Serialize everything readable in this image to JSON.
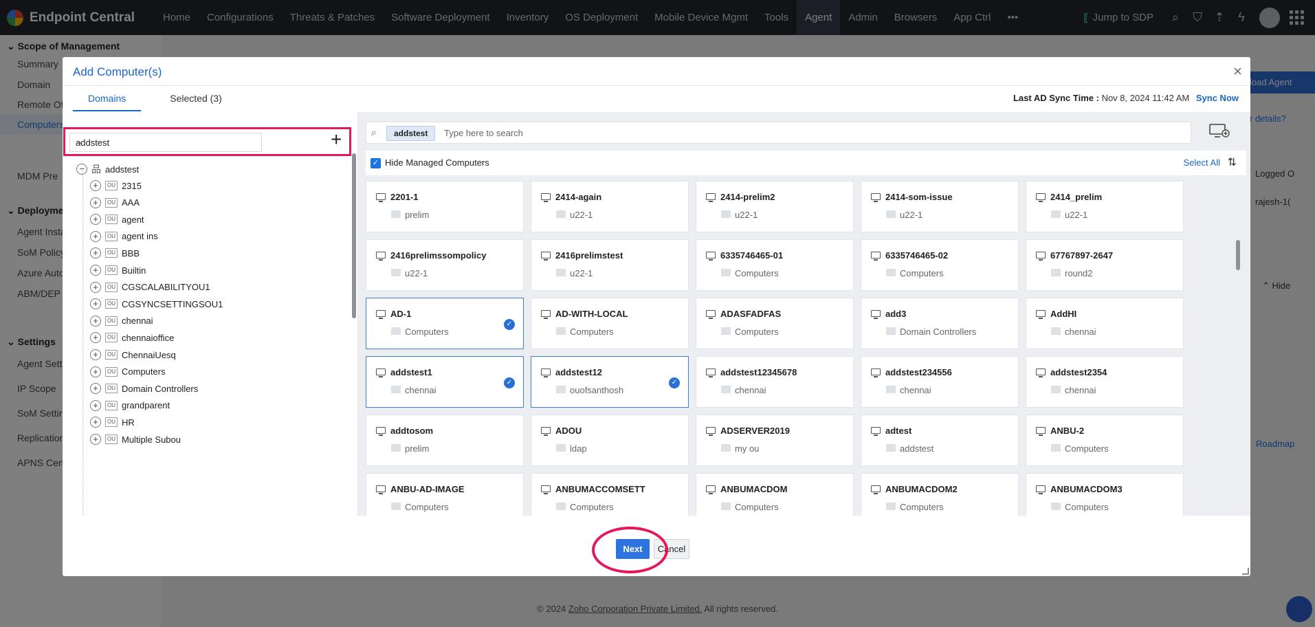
{
  "app": {
    "title": "Endpoint Central"
  },
  "nav": {
    "items": [
      "Home",
      "Configurations",
      "Threats & Patches",
      "Software Deployment",
      "Inventory",
      "OS Deployment",
      "Mobile Device Mgmt",
      "Tools",
      "Agent",
      "Admin",
      "Browsers",
      "App Ctrl"
    ],
    "active": "Agent",
    "more_icon": "more-horizontal-icon",
    "jump_label": "Jump to SDP"
  },
  "sidebar": {
    "scope_title": "Scope of Management",
    "scope_items": [
      "Summary",
      "Domain",
      "Remote Of",
      "Computers",
      "MDM Pre"
    ],
    "deploy_title": "Deployment",
    "deploy_items": [
      "Agent Insta",
      "SoM Policy",
      "Azure Auto",
      "ABM/DEP"
    ],
    "settings_title": "Settings",
    "settings_items": [
      "Agent Setti",
      "IP Scope",
      "SoM Settin",
      "Replication",
      "APNS Cert"
    ]
  },
  "background": {
    "download_btn": "load Agent",
    "details_link": "r details?",
    "logged_col": "Logged O",
    "rajesh": "rajesh-1(",
    "hide": "Hide",
    "roadmap": "Roadmap",
    "footer_copyright": "© 2024",
    "footer_company": "Zoho Corporation Private Limited.",
    "footer_rights": "All rights reserved."
  },
  "modal": {
    "title": "Add Computer(s)",
    "close": "×",
    "tabs": [
      "Domains",
      "Selected (3)"
    ],
    "sync_label": "Last AD Sync Time :",
    "sync_time": "Nov 8, 2024 11:42 AM",
    "sync_now": "Sync Now",
    "domain_value": "addstest",
    "tree_root": "addstest",
    "ou_label": "OU",
    "tree_nodes": [
      "2315",
      "AAA",
      "agent",
      "agent ins",
      "BBB",
      "Builtin",
      "CGSCALABILITYOU1",
      "CGSYNCSETTINGSOU1",
      "chennai",
      "chennaioffice",
      "ChennaiUesq",
      "Computers",
      "Domain Controllers",
      "grandparent",
      "HR",
      "Multiple Subou"
    ],
    "search_chip": "addstest",
    "search_placeholder": "Type here to search",
    "hide_managed": "Hide Managed Computers",
    "select_all": "Select All",
    "cards": [
      {
        "name": "2201-1",
        "ou": "prelim",
        "selected": false
      },
      {
        "name": "2414-again",
        "ou": "u22-1",
        "selected": false
      },
      {
        "name": "2414-prelim2",
        "ou": "u22-1",
        "selected": false
      },
      {
        "name": "2414-som-issue",
        "ou": "u22-1",
        "selected": false
      },
      {
        "name": "2414_prelim",
        "ou": "u22-1",
        "selected": false
      },
      {
        "name": "2416prelimssompolicy",
        "ou": "u22-1",
        "selected": false
      },
      {
        "name": "2416prelimstest",
        "ou": "u22-1",
        "selected": false
      },
      {
        "name": "6335746465-01",
        "ou": "Computers",
        "selected": false
      },
      {
        "name": "6335746465-02",
        "ou": "Computers",
        "selected": false
      },
      {
        "name": "67767897-2647",
        "ou": "round2",
        "selected": false
      },
      {
        "name": "AD-1",
        "ou": "Computers",
        "selected": true
      },
      {
        "name": "AD-WITH-LOCAL",
        "ou": "Computers",
        "selected": false
      },
      {
        "name": "ADASFADFAS",
        "ou": "Computers",
        "selected": false
      },
      {
        "name": "add3",
        "ou": "Domain Controllers",
        "selected": false
      },
      {
        "name": "AddHI",
        "ou": "chennai",
        "selected": false
      },
      {
        "name": "addstest1",
        "ou": "chennai",
        "selected": true
      },
      {
        "name": "addstest12",
        "ou": "ouofsanthosh",
        "selected": true
      },
      {
        "name": "addstest12345678",
        "ou": "chennai",
        "selected": false
      },
      {
        "name": "addstest234556",
        "ou": "chennai",
        "selected": false
      },
      {
        "name": "addstest2354",
        "ou": "chennai",
        "selected": false
      },
      {
        "name": "addtosom",
        "ou": "prelim",
        "selected": false
      },
      {
        "name": "ADOU",
        "ou": "ldap",
        "selected": false
      },
      {
        "name": "ADSERVER2019",
        "ou": "my ou",
        "selected": false
      },
      {
        "name": "adtest",
        "ou": "addstest",
        "selected": false
      },
      {
        "name": "ANBU-2",
        "ou": "Computers",
        "selected": false
      },
      {
        "name": "ANBU-AD-IMAGE",
        "ou": "Computers",
        "selected": false
      },
      {
        "name": "ANBUMACCOMSETT",
        "ou": "Computers",
        "selected": false
      },
      {
        "name": "ANBUMACDOM",
        "ou": "Computers",
        "selected": false
      },
      {
        "name": "ANBUMACDOM2",
        "ou": "Computers",
        "selected": false
      },
      {
        "name": "ANBUMACDOM3",
        "ou": "Computers",
        "selected": false
      }
    ],
    "next": "Next",
    "cancel": "Cancel"
  },
  "colors": {
    "accent": "#1a66c9",
    "highlight": "#e5195a",
    "nav_bg": "#22262f"
  }
}
